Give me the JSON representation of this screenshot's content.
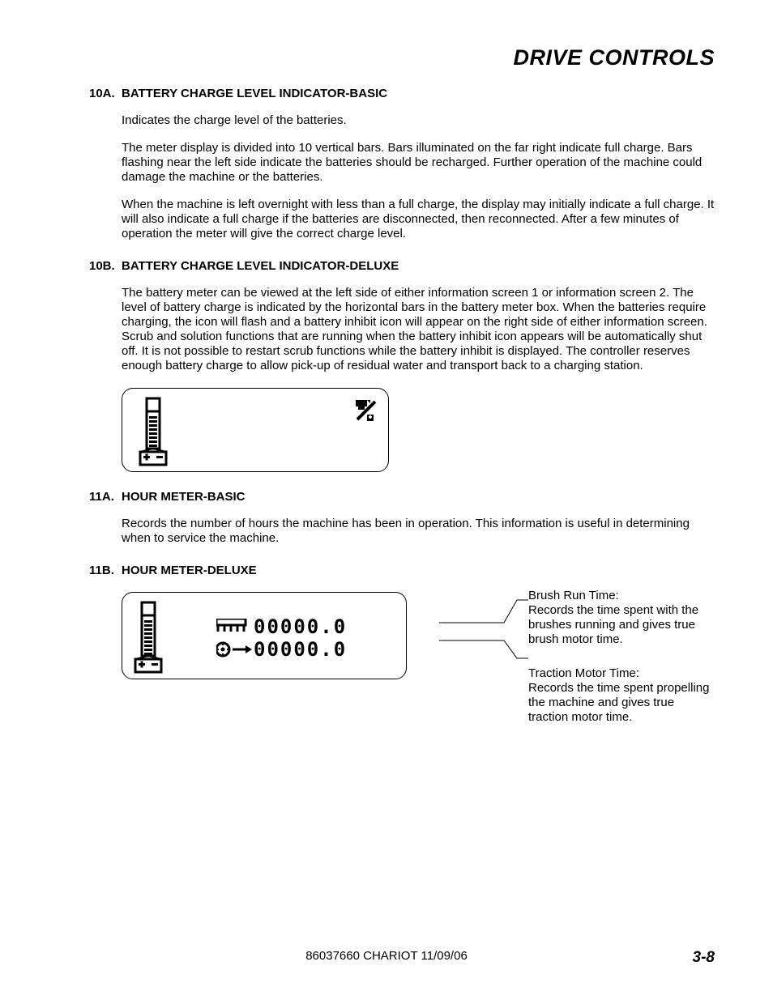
{
  "header": {
    "title": "DRIVE CONTROLS"
  },
  "sections": {
    "s10a": {
      "num": "10A.",
      "heading": "BATTERY CHARGE LEVEL INDICATOR-BASIC",
      "p1": "Indicates the charge level of the batteries.",
      "p2": "The meter display is divided into 10 vertical bars.  Bars illuminated on the far right indicate full charge.  Bars flashing near the left side indicate the batteries should be recharged.  Further operation of the machine could damage the machine or the batteries.",
      "p3": "When the machine is left overnight with less than a full charge, the display may initially indicate a full charge.  It will also indicate a full charge if the batteries are disconnected, then reconnected.  After a few minutes of operation the meter will give the correct charge level."
    },
    "s10b": {
      "num": "10B.",
      "heading": "BATTERY CHARGE LEVEL INDICATOR-DELUXE",
      "p1": "The battery meter can be viewed at the left side of either information screen 1 or information screen 2.  The level of battery charge is indicated by the horizontal bars in the battery meter box.  When the batteries require charging, the icon will flash and a battery inhibit icon will appear on the right side of either information screen.  Scrub and solution functions that are running when the battery inhibit icon appears will be automatically shut off.  It is not possible to restart scrub functions while the battery inhibit is displayed.  The controller reserves enough battery charge to allow pick-up of residual water and transport back to a charging station."
    },
    "s11a": {
      "num": "11A.",
      "heading": "HOUR METER-BASIC",
      "p1": "Records the number of hours the machine has been in operation.  This information is useful in determining when to service the machine."
    },
    "s11b": {
      "num": "11B.",
      "heading": "HOUR METER-DELUXE",
      "row1_label": "Brush Run Time:",
      "row1_value": "00000.0",
      "row1_desc": "Records the time spent with the brushes running and gives true brush motor time.",
      "row2_label": "Traction Motor Time:",
      "row2_value": "00000.0",
      "row2_desc": "Records the time spent propelling the machine and gives true traction motor time."
    }
  },
  "icons": {
    "battery_meter": "battery-meter",
    "battery_inhibit": "battery-inhibit-icon",
    "brush": "brush-icon",
    "traction": "traction-icon"
  },
  "footer": {
    "center": "86037660 CHARIOT 11/09/06",
    "right": "3-8"
  }
}
